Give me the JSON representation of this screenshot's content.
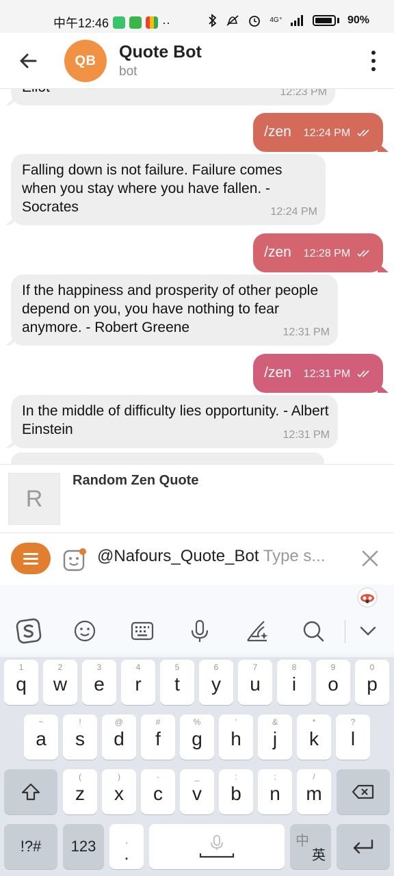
{
  "status": {
    "time": "中午12:46",
    "net": "4G⁺",
    "battery": "90%"
  },
  "header": {
    "avatar_initials": "QB",
    "title": "Quote Bot",
    "subtitle": "bot"
  },
  "messages": [
    {
      "dir": "in",
      "text": "Eliot",
      "time": "12:23 PM"
    },
    {
      "dir": "out",
      "text": "/zen",
      "time": "12:24 PM"
    },
    {
      "dir": "in",
      "text": "Falling down is not failure. Failure comes when you stay where you have fallen. - Socrates",
      "time": "12:24 PM"
    },
    {
      "dir": "out",
      "text": "/zen",
      "time": "12:28 PM"
    },
    {
      "dir": "in",
      "text": "If the happiness and prosperity of other people depend on you, you have nothing to fear anymore. - Robert Greene",
      "time": "12:31 PM"
    },
    {
      "dir": "out",
      "text": "/zen",
      "time": "12:31 PM"
    },
    {
      "dir": "in",
      "text": "In the middle of difficulty lies opportunity. - Albert Einstein",
      "time": "12:31 PM"
    }
  ],
  "preview": {
    "thumb_letter": "R",
    "title": "Random Zen Quote"
  },
  "input": {
    "value": "@Nafours_Quote_Bot",
    "placeholder": "Type s..."
  },
  "keyboard": {
    "row1": [
      {
        "main": "q",
        "sub": "1"
      },
      {
        "main": "w",
        "sub": "2"
      },
      {
        "main": "e",
        "sub": "3"
      },
      {
        "main": "r",
        "sub": "4"
      },
      {
        "main": "t",
        "sub": "5"
      },
      {
        "main": "y",
        "sub": "6"
      },
      {
        "main": "u",
        "sub": "7"
      },
      {
        "main": "i",
        "sub": "8"
      },
      {
        "main": "o",
        "sub": "9"
      },
      {
        "main": "p",
        "sub": "0"
      }
    ],
    "row2": [
      {
        "main": "a",
        "sub": "~"
      },
      {
        "main": "s",
        "sub": "!"
      },
      {
        "main": "d",
        "sub": "@"
      },
      {
        "main": "f",
        "sub": "#"
      },
      {
        "main": "g",
        "sub": "%"
      },
      {
        "main": "h",
        "sub": "'"
      },
      {
        "main": "j",
        "sub": "&"
      },
      {
        "main": "k",
        "sub": "*"
      },
      {
        "main": "l",
        "sub": "?"
      }
    ],
    "row3": [
      {
        "main": "z",
        "sub": "("
      },
      {
        "main": "x",
        "sub": ")"
      },
      {
        "main": "c",
        "sub": "-"
      },
      {
        "main": "v",
        "sub": "_"
      },
      {
        "main": "b",
        "sub": ":"
      },
      {
        "main": "n",
        "sub": ";"
      },
      {
        "main": "m",
        "sub": "/"
      }
    ],
    "symbols_label": "!?#",
    "numbers_label": "123",
    "punct_top": ",",
    "punct_bottom": ".",
    "lang_top": "中",
    "lang_bottom": "英"
  },
  "colors": {
    "accent": "#e27f2f",
    "out_bubbles": [
      "#d46a5a",
      "#d4646e",
      "#d15f7a"
    ],
    "in_bubble": "#eeeeee"
  }
}
